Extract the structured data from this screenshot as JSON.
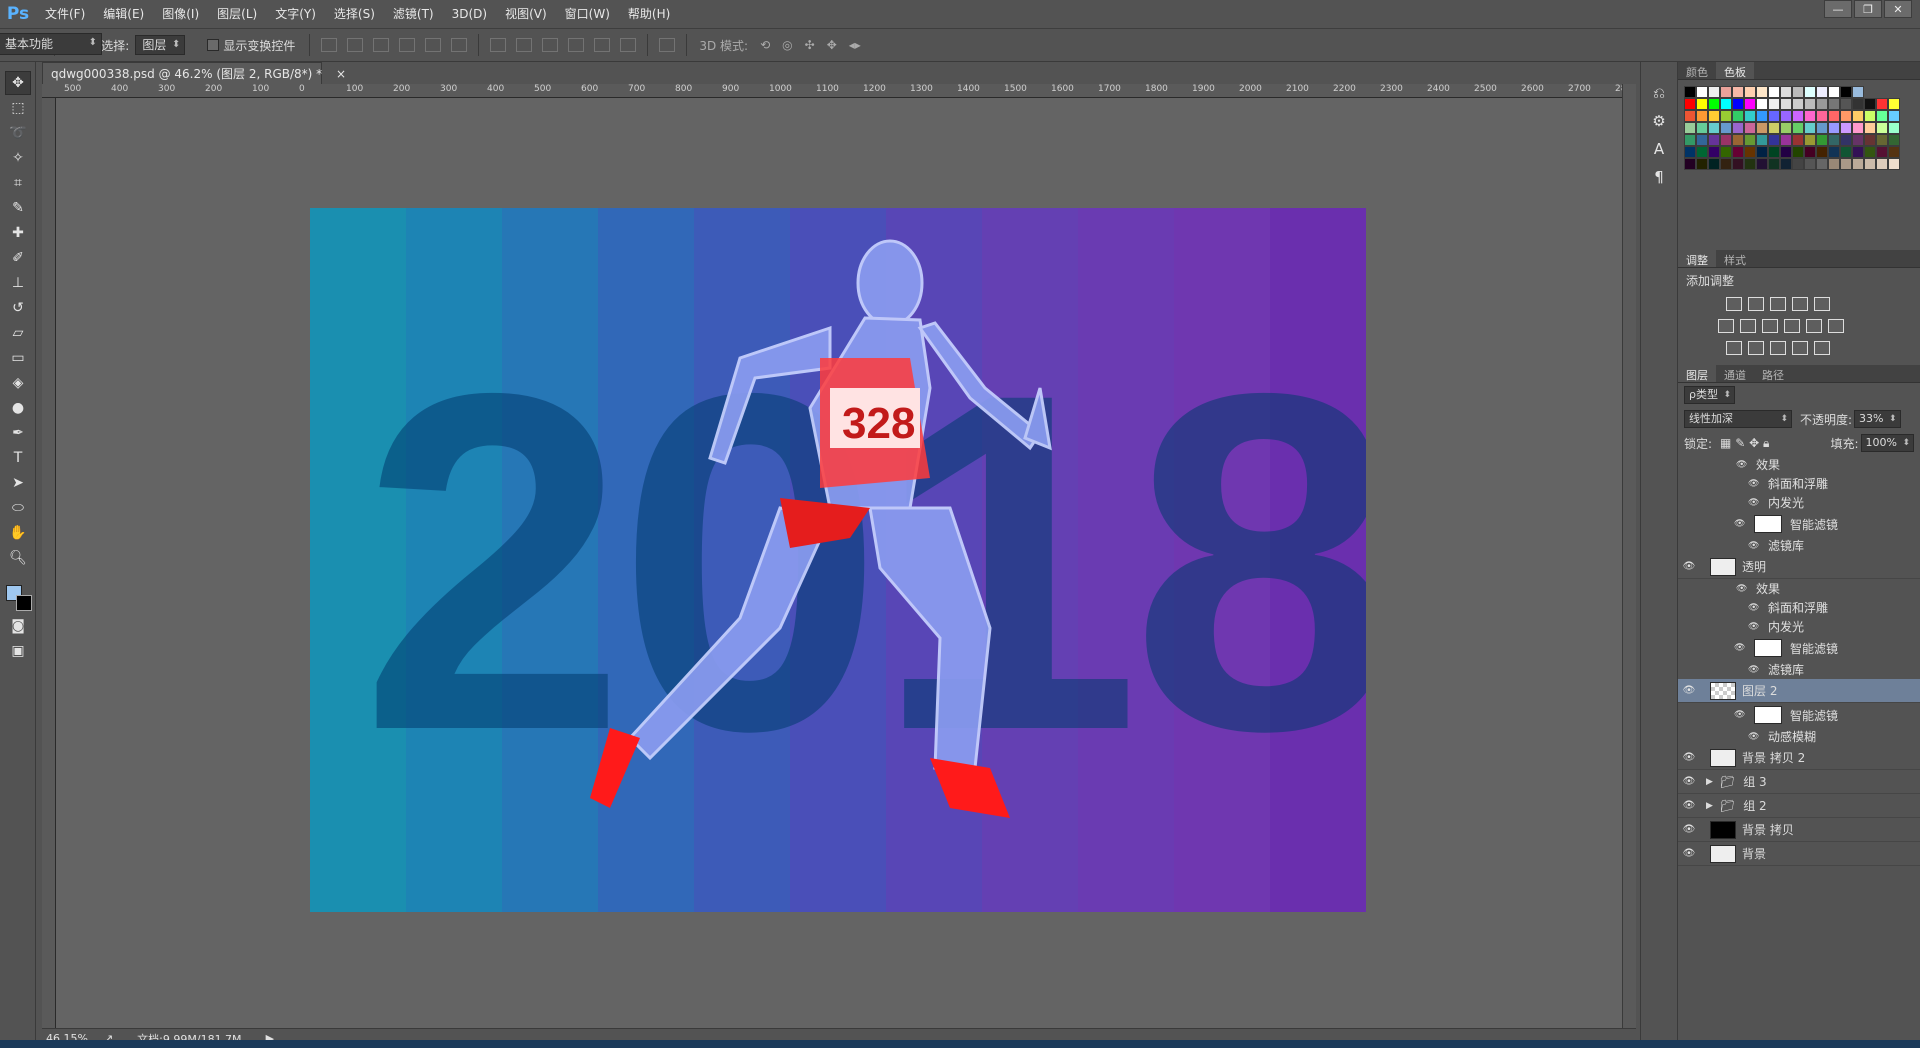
{
  "app": {
    "logo": "Ps"
  },
  "menu": [
    "文件(F)",
    "编辑(E)",
    "图像(I)",
    "图层(L)",
    "文字(Y)",
    "选择(S)",
    "滤镜(T)",
    "3D(D)",
    "视图(V)",
    "窗口(W)",
    "帮助(H)"
  ],
  "window_controls": [
    "—",
    "❐",
    "✕"
  ],
  "options": {
    "auto_select_label": "自动选择:",
    "auto_select_value": "图层",
    "show_transform_label": "显示变换控件",
    "mode_3d_label": "3D 模式:",
    "workspace": "基本功能"
  },
  "document": {
    "tab_title": "qdwg000338.psd @ 46.2% (图层 2, RGB/8*) *",
    "tab_close": "×",
    "poster_text": "2018",
    "bib_number": "328"
  },
  "ruler": {
    "top": [
      "500",
      "400",
      "300",
      "200",
      "100",
      "0",
      "100",
      "200",
      "300",
      "400",
      "500",
      "600",
      "700",
      "800",
      "900",
      "1000",
      "1100",
      "1200",
      "1300",
      "1400",
      "1500",
      "1600",
      "1700",
      "1800",
      "1900",
      "2000",
      "2100",
      "2200",
      "2300",
      "2400",
      "2500",
      "2600",
      "2700",
      "28"
    ]
  },
  "status": {
    "zoom": "46.15%",
    "doc_info": "文档:9.99M/181.7M"
  },
  "panels": {
    "color_tabs": [
      "颜色",
      "色板"
    ],
    "adjust_tabs": [
      "调整",
      "样式"
    ],
    "adjust_title": "添加调整",
    "layer_tabs": [
      "图层",
      "通道",
      "路径"
    ],
    "filter_kind": "ρ类型",
    "blend_mode": "线性加深",
    "opacity_label": "不透明度:",
    "opacity_value": "33%",
    "lock_label": "锁定:",
    "fill_label": "填充:",
    "fill_value": "100%"
  },
  "layers": [
    {
      "kind": "fx",
      "name": "效果"
    },
    {
      "kind": "fx2",
      "name": "斜面和浮雕"
    },
    {
      "kind": "fx2",
      "name": "内发光"
    },
    {
      "kind": "filter",
      "name": "智能滤镜"
    },
    {
      "kind": "fx2",
      "name": "滤镜库"
    },
    {
      "kind": "layer",
      "name": "透明"
    },
    {
      "kind": "fx",
      "name": "效果"
    },
    {
      "kind": "fx2",
      "name": "斜面和浮雕"
    },
    {
      "kind": "fx2",
      "name": "内发光"
    },
    {
      "kind": "filter",
      "name": "智能滤镜"
    },
    {
      "kind": "fx2",
      "name": "滤镜库"
    },
    {
      "kind": "layer-sel",
      "name": "图层 2"
    },
    {
      "kind": "filter",
      "name": "智能滤镜"
    },
    {
      "kind": "fx2",
      "name": "动感模糊"
    },
    {
      "kind": "layer",
      "name": "背景 拷贝 2"
    },
    {
      "kind": "group",
      "name": "组 3"
    },
    {
      "kind": "group",
      "name": "组 2"
    },
    {
      "kind": "layer",
      "name": "背景 拷贝"
    },
    {
      "kind": "layer",
      "name": "背景"
    }
  ],
  "colors": {
    "stripes": [
      "#1a8fb0",
      "#1d84b4",
      "#2677b6",
      "#3168b8",
      "#3d5bb8",
      "#4a4fb8",
      "#5846b6",
      "#6440b3",
      "#6a3bb2",
      "#6f37b0",
      "#6a2fae"
    ],
    "accent": "#5ab3ff"
  }
}
